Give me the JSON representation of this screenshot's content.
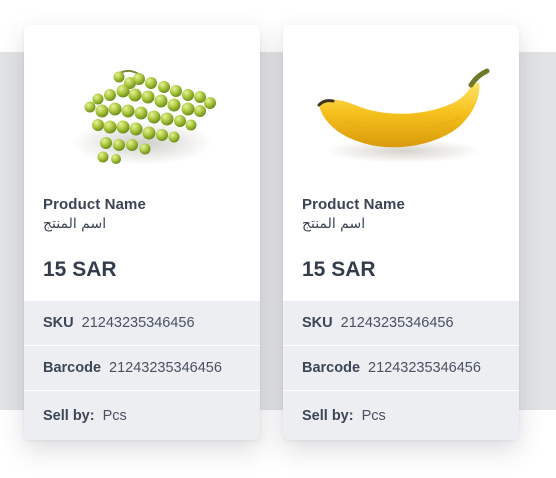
{
  "products": [
    {
      "image_icon": "grapes-image",
      "name_en": "Product Name",
      "name_ar": "اسم المنتج",
      "price": "15 SAR",
      "sku_label": "SKU",
      "sku_value": "21243235346456",
      "barcode_label": "Barcode",
      "barcode_value": "21243235346456",
      "sellby_label": "Sell by:",
      "sellby_value": "Pcs"
    },
    {
      "image_icon": "banana-image",
      "name_en": "Product Name",
      "name_ar": "اسم المنتج",
      "price": "15 SAR",
      "sku_label": "SKU",
      "sku_value": "21243235346456",
      "barcode_label": "Barcode",
      "barcode_value": "21243235346456",
      "sellby_label": "Sell by:",
      "sellby_value": "Pcs"
    }
  ],
  "colors": {
    "card_background": "#ffffff",
    "info_background": "#eceef1",
    "backdrop": "#e2e3e5",
    "text": "#3b4454"
  }
}
